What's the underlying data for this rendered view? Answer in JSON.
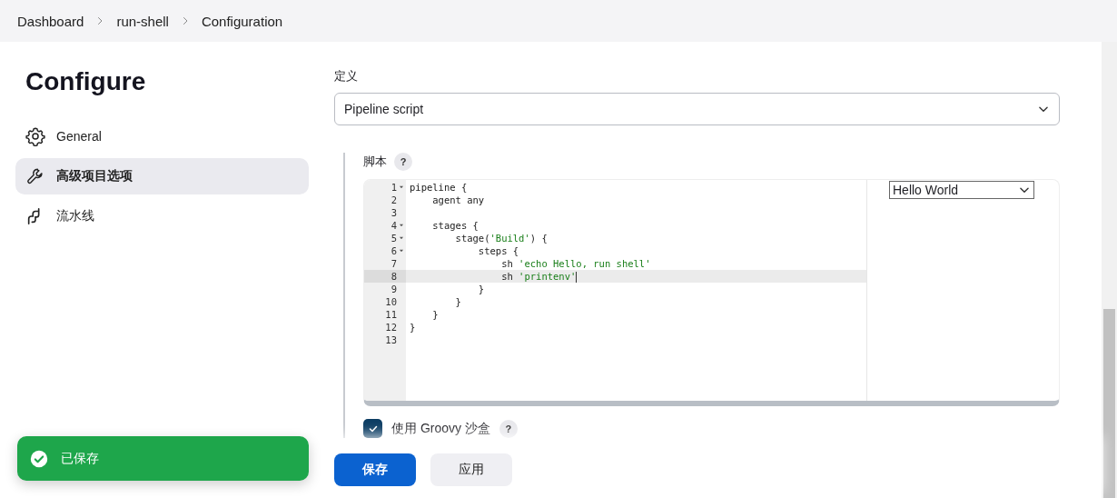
{
  "breadcrumbs": [
    {
      "label": "Dashboard"
    },
    {
      "label": "run-shell"
    },
    {
      "label": "Configuration"
    }
  ],
  "sidebar": {
    "title": "Configure",
    "items": [
      {
        "label": "General",
        "selected": false
      },
      {
        "label": "高级项目选项",
        "selected": true
      },
      {
        "label": "流水线",
        "selected": false
      }
    ]
  },
  "definition": {
    "label": "定义",
    "value": "Pipeline script"
  },
  "script": {
    "label": "脚本",
    "help": "?",
    "snippet": "Hello World",
    "lines": [
      {
        "number": "1",
        "foldable": true,
        "selected": false,
        "segments": [
          {
            "text": "pipeline {",
            "kind": "plain"
          }
        ]
      },
      {
        "number": "2",
        "foldable": false,
        "selected": false,
        "segments": [
          {
            "text": "    agent any",
            "kind": "plain"
          }
        ]
      },
      {
        "number": "3",
        "foldable": false,
        "selected": false
      },
      {
        "number": "4",
        "foldable": true,
        "selected": false,
        "segments": [
          {
            "text": "    stages {",
            "kind": "plain"
          }
        ]
      },
      {
        "number": "5",
        "foldable": true,
        "selected": false,
        "segments": [
          {
            "text": "        stage(",
            "kind": "plain"
          },
          {
            "text": "'Build'",
            "kind": "string"
          },
          {
            "text": ") {",
            "kind": "plain"
          }
        ]
      },
      {
        "number": "6",
        "foldable": true,
        "selected": false,
        "segments": [
          {
            "text": "            steps {",
            "kind": "plain"
          }
        ]
      },
      {
        "number": "7",
        "foldable": false,
        "selected": false,
        "segments": [
          {
            "text": "                sh ",
            "kind": "plain"
          },
          {
            "text": "'echo Hello, run shell'",
            "kind": "string"
          }
        ]
      },
      {
        "number": "8",
        "foldable": false,
        "selected": true,
        "segments": [
          {
            "text": "                sh ",
            "kind": "plain"
          },
          {
            "text": "'printenv'",
            "kind": "string"
          }
        ]
      },
      {
        "number": "9",
        "foldable": false,
        "selected": false,
        "segments": [
          {
            "text": "            }",
            "kind": "plain"
          }
        ]
      },
      {
        "number": "10",
        "foldable": false,
        "selected": false,
        "segments": [
          {
            "text": "        }",
            "kind": "plain"
          }
        ]
      },
      {
        "number": "11",
        "foldable": false,
        "selected": false,
        "segments": [
          {
            "text": "    }",
            "kind": "plain"
          }
        ]
      },
      {
        "number": "12",
        "foldable": false,
        "selected": false,
        "segments": [
          {
            "text": "}",
            "kind": "plain"
          }
        ]
      },
      {
        "number": "13",
        "foldable": false,
        "selected": false
      }
    ]
  },
  "sandbox": {
    "label": "使用 Groovy 沙盒",
    "help": "?",
    "checked": true
  },
  "buttons": [
    {
      "label": "保存",
      "kind": "primary"
    },
    {
      "label": "应用",
      "kind": "secondary"
    }
  ],
  "toast": {
    "message": "已保存"
  }
}
